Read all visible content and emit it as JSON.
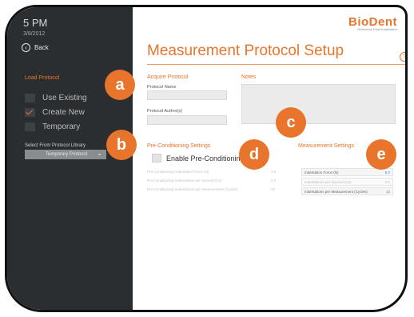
{
  "sidebar": {
    "time": "5 PM",
    "date": "3/8/2012",
    "back_label": "Back",
    "load_protocol_title": "Load Protocol",
    "options": [
      {
        "label": "Use Existing",
        "checked": false
      },
      {
        "label": "Create New",
        "checked": true
      },
      {
        "label": "Temporary",
        "checked": false
      }
    ],
    "library_label": "Select From Protocol Library",
    "library_selected": "Temporary Protocol"
  },
  "brand": {
    "logo_text": "BioDent",
    "tagline": "Reference Point Indentation",
    "accent_color": "#e9742b"
  },
  "page": {
    "title": "Measurement Protocol Setup"
  },
  "acquire": {
    "title": "Acquire Protocol",
    "name_label": "Protocol Name",
    "authors_label": "Protocol Author(s)"
  },
  "notes": {
    "title": "Notes"
  },
  "preconditioning": {
    "title": "Pre-Conditioning Settings",
    "enable_label": "Enable Pre-Conditioning",
    "params": [
      {
        "label": "Pre-Conditioning Indentation Force (N)",
        "value": "4.0"
      },
      {
        "label": "Pre-Conditioning Indentations per Second (Hz)",
        "value": "2.0"
      },
      {
        "label": "Pre-Conditioning Indentations per Measurement (Cycles)",
        "value": "10"
      }
    ]
  },
  "measurement": {
    "title": "Measurement Settings",
    "rows": [
      {
        "label": "Indentation Force (N)",
        "value": "6.0"
      },
      {
        "label": "Indentations per Second (Hz)",
        "value": "2.0"
      },
      {
        "label": "Indentations per Measurement (Cycles)",
        "value": "10"
      }
    ]
  },
  "callouts": [
    "a",
    "b",
    "c",
    "d",
    "e"
  ]
}
